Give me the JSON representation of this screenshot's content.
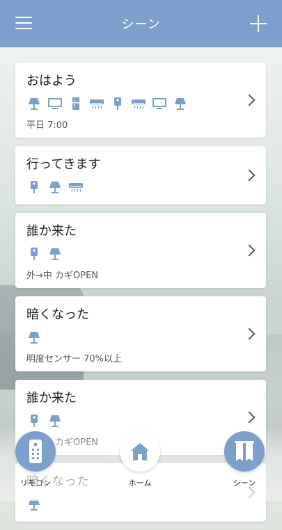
{
  "header": {
    "title": "シーン"
  },
  "scenes": [
    {
      "name": "おはよう",
      "icons": [
        "lamp-icon",
        "tv-icon",
        "fridge-icon",
        "aircon-icon",
        "key-icon",
        "aircon-icon",
        "tv-icon",
        "lamp-icon"
      ],
      "sub": "平日 7:00"
    },
    {
      "name": "行ってきます",
      "icons": [
        "key-icon",
        "lamp-icon",
        "aircon-icon"
      ],
      "sub": ""
    },
    {
      "name": "誰か来た",
      "icons": [
        "key-icon",
        "lamp-icon"
      ],
      "sub": "外→中 カギOPEN"
    },
    {
      "name": "暗くなった",
      "icons": [
        "lamp-icon"
      ],
      "sub": "明度センサー 70%以上"
    },
    {
      "name": "誰か来た",
      "icons": [
        "key-icon",
        "lamp-icon"
      ],
      "sub": "外→中 カギOPEN"
    },
    {
      "name": "暗くなった",
      "icons": [
        "lamp-icon"
      ],
      "sub": ""
    }
  ],
  "bottom_nav": {
    "remote": "リモコン",
    "home": "ホーム",
    "scene": "シーン"
  },
  "colors": {
    "accent": "#7d9fcb",
    "icon": "#7d9fcb"
  }
}
